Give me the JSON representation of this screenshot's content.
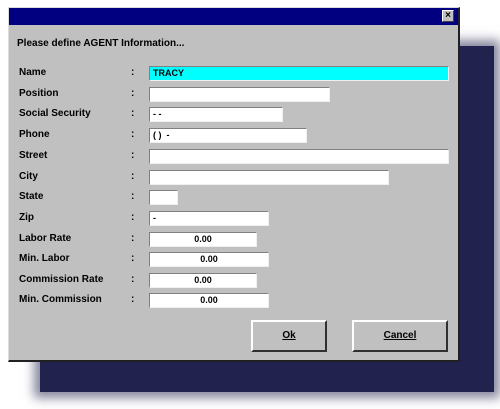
{
  "dialog": {
    "close_glyph": "×",
    "prompt": "Please define AGENT Information..."
  },
  "fields": [
    {
      "label": "Name",
      "value": "TRACY"
    },
    {
      "label": "Position",
      "value": ""
    },
    {
      "label": "Social Security",
      "value": "- -"
    },
    {
      "label": "Phone",
      "value": "( )  -"
    },
    {
      "label": "Street",
      "value": ""
    },
    {
      "label": "City",
      "value": ""
    },
    {
      "label": "State",
      "value": ""
    },
    {
      "label": "Zip",
      "value": "-"
    },
    {
      "label": "Labor Rate",
      "value": "0.00"
    },
    {
      "label": "Min. Labor",
      "value": "0.00"
    },
    {
      "label": "Commission Rate",
      "value": "0.00"
    },
    {
      "label": "Min. Commission",
      "value": "0.00"
    }
  ],
  "separator": ":",
  "buttons": {
    "ok": "Ok",
    "cancel": "Cancel"
  },
  "colors": {
    "titlebar": "#000080",
    "dialog_bg": "#c0c0c0",
    "active_field": "#00ffff",
    "shadow": "#22224e"
  }
}
